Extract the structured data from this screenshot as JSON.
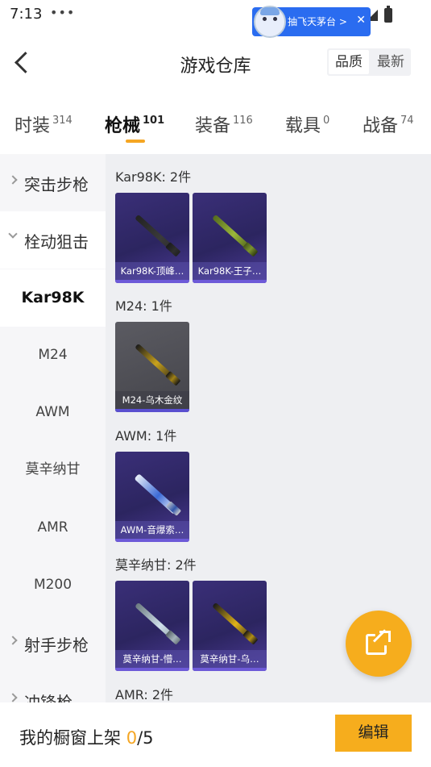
{
  "status": {
    "time": "7:13",
    "dots": "•••"
  },
  "promo": {
    "text": "抽飞天茅台 >",
    "close": "✕"
  },
  "header": {
    "title": "游戏仓库",
    "sort_quality": "品质",
    "sort_latest": "最新"
  },
  "tabs": [
    {
      "label": "时装",
      "count": "314"
    },
    {
      "label": "枪械",
      "count": "101"
    },
    {
      "label": "装备",
      "count": "116"
    },
    {
      "label": "载具",
      "count": "0"
    },
    {
      "label": "战备",
      "count": "74"
    }
  ],
  "sidebar": {
    "assault": "突击步枪",
    "bolt": "栓动狙击",
    "subs": [
      "Kar98K",
      "M24",
      "AWM",
      "莫辛纳甘",
      "AMR",
      "M200"
    ],
    "marksman": "射手步枪",
    "smg": "冲锋枪"
  },
  "sections": [
    {
      "title": "Kar98K: 2件",
      "items": [
        "Kar98K-顶峰…",
        "Kar98K-王子…"
      ]
    },
    {
      "title": "M24: 1件",
      "items": [
        "M24-乌木金纹"
      ]
    },
    {
      "title": "AWM: 1件",
      "items": [
        "AWM-音爆索…"
      ]
    },
    {
      "title": "莫辛纳甘: 2件",
      "items": [
        "莫辛纳甘-懵…",
        "莫辛纳甘-乌…"
      ]
    },
    {
      "title": "AMR: 2件"
    }
  ],
  "bottom": {
    "label": "我的橱窗上架 ",
    "current": "0",
    "total": "/5",
    "edit": "编辑"
  },
  "colors": {
    "accent": "#f6ad1d",
    "card_purple": "#3a2f78"
  }
}
